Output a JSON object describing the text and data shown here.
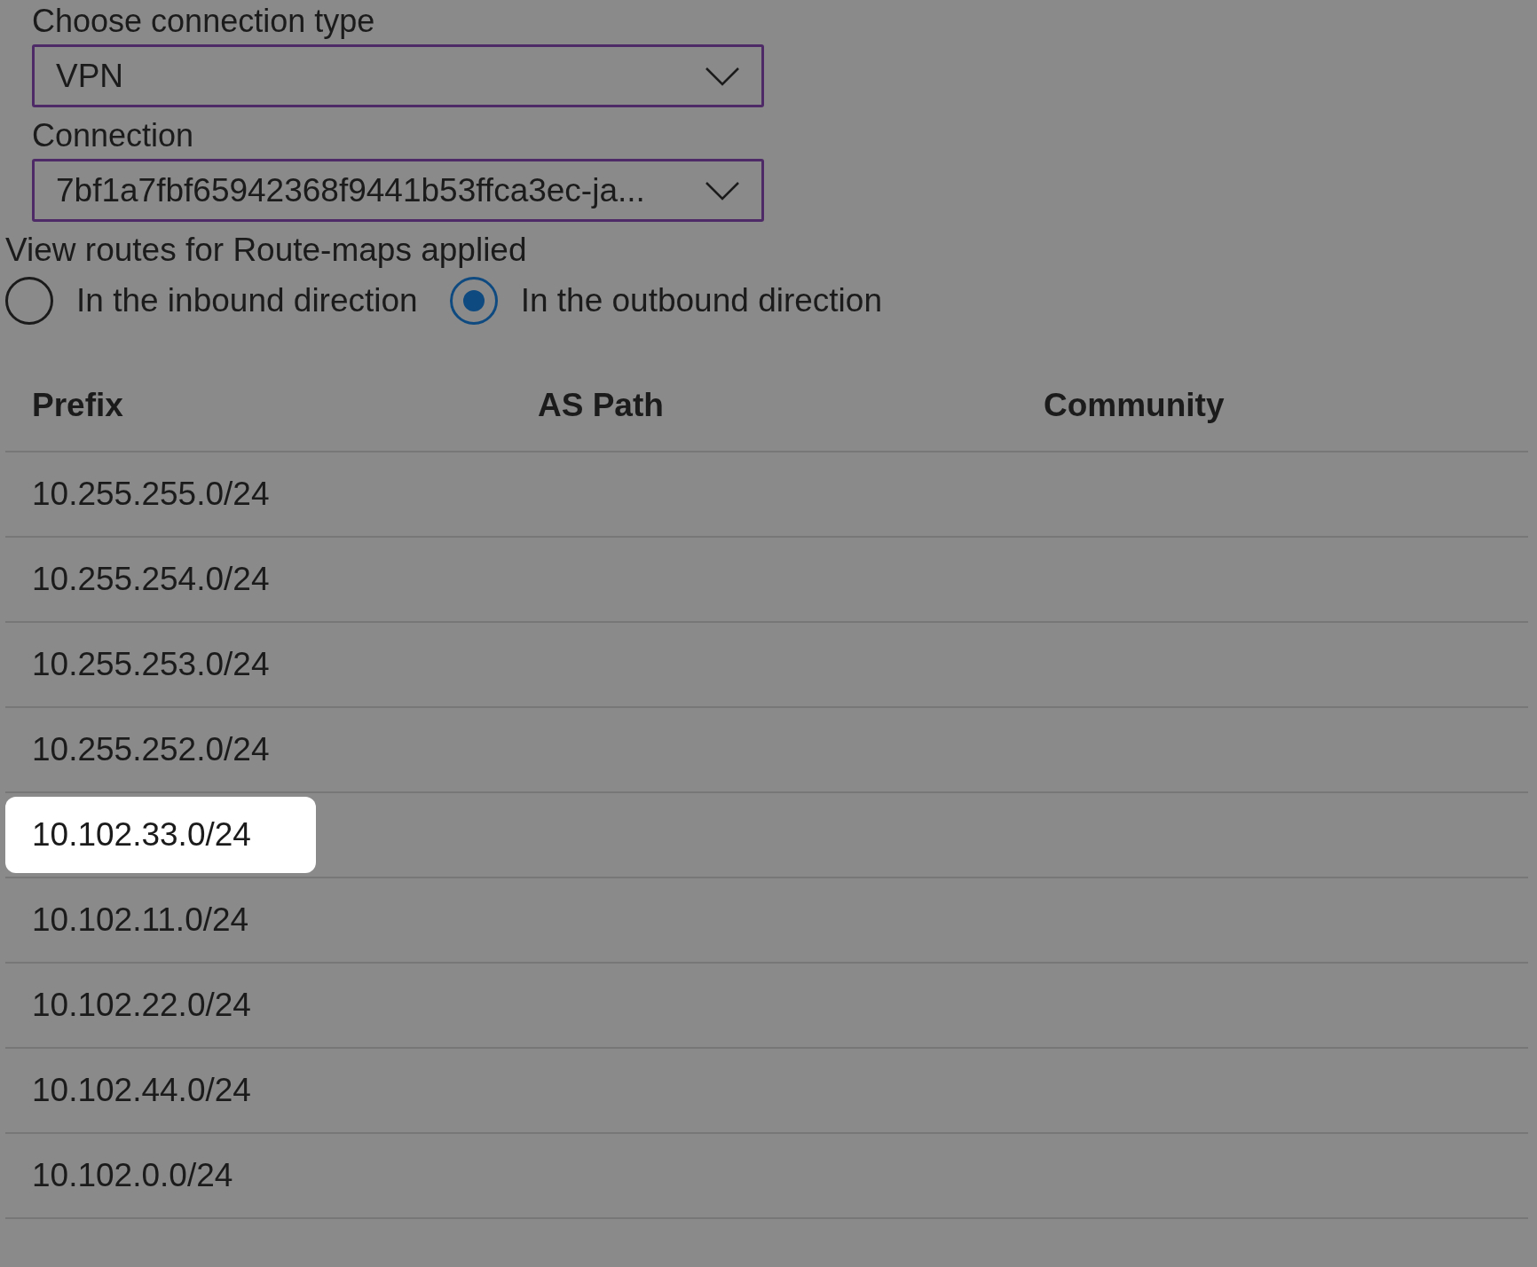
{
  "connection_type": {
    "label": "Choose connection type",
    "value": "VPN"
  },
  "connection": {
    "label": "Connection",
    "value": "7bf1a7fbf65942368f9441b53ffca3ec-ja..."
  },
  "direction": {
    "label": "View routes for Route-maps applied",
    "options": [
      {
        "label": "In the inbound direction",
        "selected": false
      },
      {
        "label": "In the outbound direction",
        "selected": true
      }
    ]
  },
  "table": {
    "columns": [
      "Prefix",
      "AS Path",
      "Community"
    ],
    "rows": [
      {
        "prefix": "10.255.255.0/24",
        "highlighted": false
      },
      {
        "prefix": "10.255.254.0/24",
        "highlighted": false
      },
      {
        "prefix": "10.255.253.0/24",
        "highlighted": false
      },
      {
        "prefix": "10.255.252.0/24",
        "highlighted": false
      },
      {
        "prefix": "10.102.33.0/24",
        "highlighted": true
      },
      {
        "prefix": "10.102.11.0/24",
        "highlighted": false
      },
      {
        "prefix": "10.102.22.0/24",
        "highlighted": false
      },
      {
        "prefix": "10.102.44.0/24",
        "highlighted": false
      },
      {
        "prefix": "10.102.0.0/24",
        "highlighted": false
      }
    ]
  }
}
